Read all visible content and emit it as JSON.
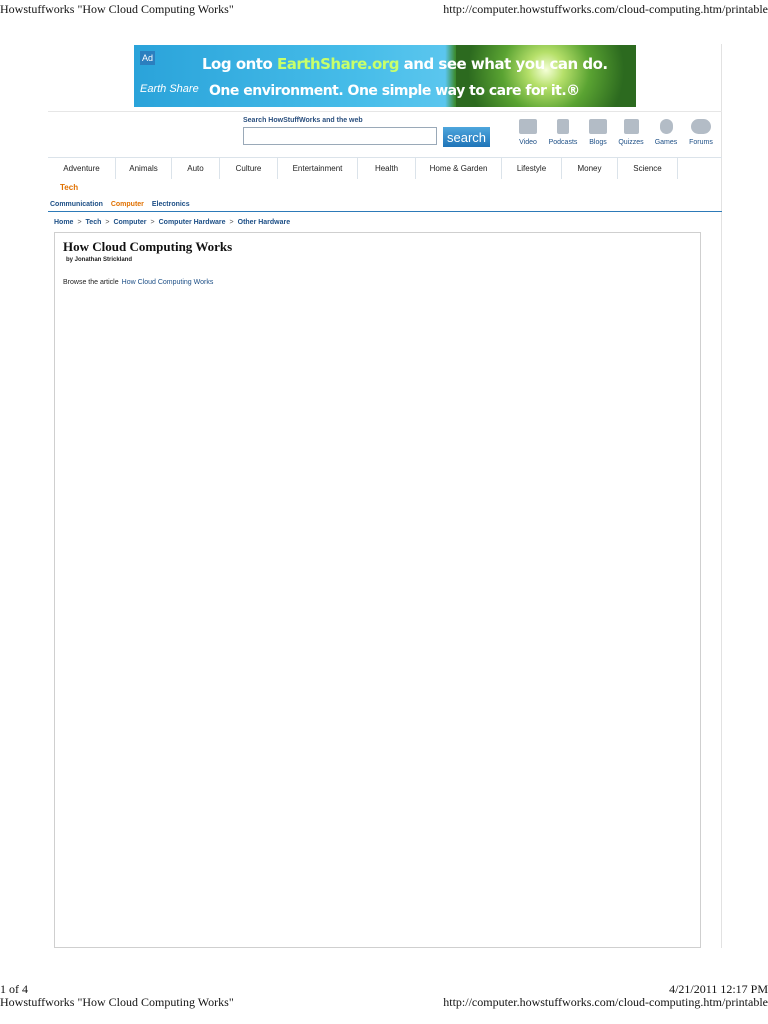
{
  "print_header": {
    "title": "Howstuffworks \"How Cloud Computing Works\"",
    "url": "http://computer.howstuffworks.com/cloud-computing.htm/printable"
  },
  "print_footer": {
    "page_count": "1 of 4",
    "datetime": "4/21/2011 12:17 PM",
    "title": "Howstuffworks \"How Cloud Computing Works\"",
    "url": "http://computer.howstuffworks.com/cloud-computing.htm/printable"
  },
  "banner": {
    "logo_mark": "Ad",
    "brand": "Earth Share",
    "headline_pre": "Log onto ",
    "headline_site": "EarthShare.org",
    "headline_post": " and see what you can do.",
    "subline": "One environment. One simple way to care for it.®"
  },
  "search": {
    "label": "Search HowStuffWorks and the web",
    "value": "",
    "placeholder": "",
    "button": "search"
  },
  "quick_links": [
    {
      "label": "Video",
      "icon": "video-camera-icon"
    },
    {
      "label": "Podcasts",
      "icon": "podcast-player-icon"
    },
    {
      "label": "Blogs",
      "icon": "speech-bubble-icon"
    },
    {
      "label": "Quizzes",
      "icon": "question-mark-icon"
    },
    {
      "label": "Games",
      "icon": "chess-knight-icon"
    },
    {
      "label": "Forums",
      "icon": "people-icon"
    }
  ],
  "nav": {
    "items": [
      "Adventure",
      "Animals",
      "Auto",
      "Culture",
      "Entertainment",
      "Health",
      "Home & Garden",
      "Lifestyle",
      "Money",
      "Science"
    ],
    "tech": "Tech"
  },
  "subnav": {
    "items": [
      "Communication",
      "Computer",
      "Electronics"
    ],
    "active": "Computer"
  },
  "breadcrumb": [
    "Home",
    "Tech",
    "Computer",
    "Computer Hardware",
    "Other Hardware"
  ],
  "breadcrumb_separator": ">",
  "article": {
    "title": "How Cloud Computing Works",
    "byline": "by Jonathan Strickland",
    "browse_label": "Browse the article",
    "browse_link": "How Cloud Computing Works"
  },
  "colors": {
    "link": "#1d4f86",
    "active": "#e07000",
    "search_button": "#1f74b8"
  }
}
